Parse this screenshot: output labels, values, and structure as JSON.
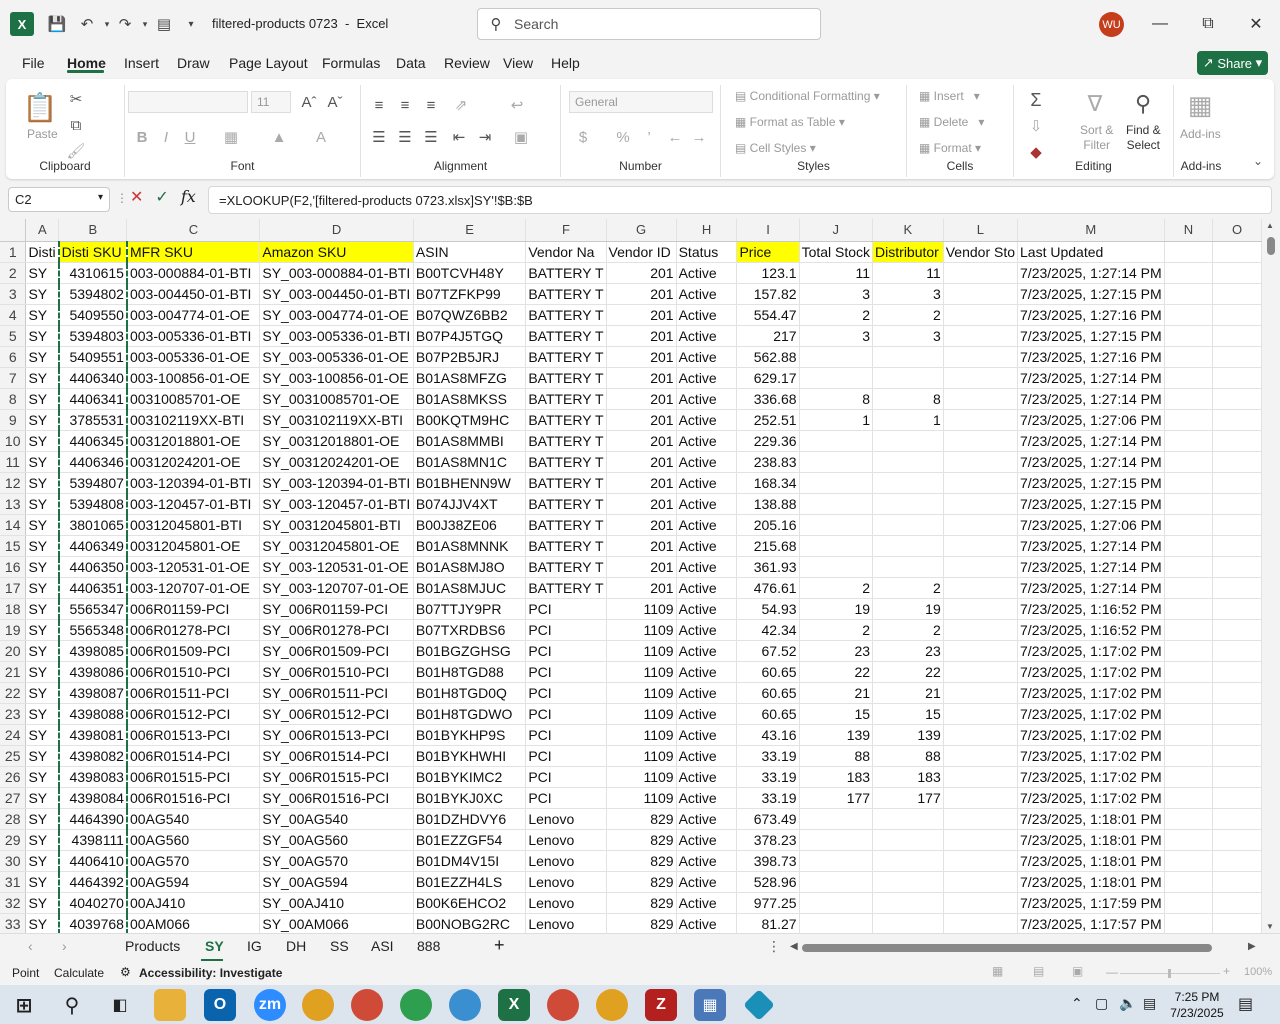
{
  "title_bar": {
    "filename": "filtered-products 0723",
    "app": "Excel",
    "search_placeholder": "Search",
    "user_initials": "WU",
    "app_logo": "X"
  },
  "menu": [
    "File",
    "Home",
    "Insert",
    "Draw",
    "Page Layout",
    "Formulas",
    "Data",
    "Review",
    "View",
    "Help"
  ],
  "share_label": "Share",
  "ribbon": {
    "clipboard": {
      "paste": "Paste",
      "label": "Clipboard"
    },
    "font": {
      "font_size": "11",
      "label": "Font"
    },
    "alignment": {
      "label": "Alignment"
    },
    "number": {
      "format": "General",
      "label": "Number"
    },
    "styles": {
      "conditional": "Conditional Formatting",
      "format_table": "Format as Table",
      "cell_styles": "Cell Styles",
      "label": "Styles"
    },
    "cells": {
      "insert": "Insert",
      "delete": "Delete",
      "format": "Format",
      "label": "Cells"
    },
    "editing": {
      "sort1": "Sort &",
      "sort2": "Filter",
      "find1": "Find &",
      "find2": "Select",
      "label": "Editing"
    },
    "addins": {
      "name": "Add-ins",
      "label": "Add-ins"
    }
  },
  "formula_bar": {
    "name_box": "C2",
    "formula": "=XLOOKUP(F2,'[filtered-products 0723.xlsx]SY'!$B:$B"
  },
  "columns": [
    "A",
    "B",
    "C",
    "D",
    "E",
    "F",
    "G",
    "H",
    "I",
    "J",
    "K",
    "L",
    "M",
    "N",
    "O"
  ],
  "header_row": [
    "Disti",
    "Disti SKU",
    "MFR SKU",
    "Amazon SKU",
    "ASIN",
    "Vendor Na",
    "Vendor ID",
    "Status",
    "Price",
    "Total Stock",
    "Distributor",
    "Vendor Sto",
    "Last Updated",
    "",
    ""
  ],
  "rows": [
    [
      "SY",
      "4310615",
      "003-000884-01-BTI",
      "SY_003-000884-01-BTI",
      "B00TCVH48Y",
      "BATTERY T",
      "201",
      "Active",
      "123.1",
      "11",
      "11",
      "",
      "7/23/2025, 1:27:14 PM"
    ],
    [
      "SY",
      "5394802",
      "003-004450-01-BTI",
      "SY_003-004450-01-BTI",
      "B07TZFKP99",
      "BATTERY T",
      "201",
      "Active",
      "157.82",
      "3",
      "3",
      "",
      "7/23/2025, 1:27:15 PM"
    ],
    [
      "SY",
      "5409550",
      "003-004774-01-OE",
      "SY_003-004774-01-OE",
      "B07QWZ6BB2",
      "BATTERY T",
      "201",
      "Active",
      "554.47",
      "2",
      "2",
      "",
      "7/23/2025, 1:27:16 PM"
    ],
    [
      "SY",
      "5394803",
      "003-005336-01-BTI",
      "SY_003-005336-01-BTI",
      "B07P4J5TGQ",
      "BATTERY T",
      "201",
      "Active",
      "217",
      "3",
      "3",
      "",
      "7/23/2025, 1:27:15 PM"
    ],
    [
      "SY",
      "5409551",
      "003-005336-01-OE",
      "SY_003-005336-01-OE",
      "B07P2B5JRJ",
      "BATTERY T",
      "201",
      "Active",
      "562.88",
      "",
      "",
      "",
      "7/23/2025, 1:27:16 PM"
    ],
    [
      "SY",
      "4406340",
      "003-100856-01-OE",
      "SY_003-100856-01-OE",
      "B01AS8MFZG",
      "BATTERY T",
      "201",
      "Active",
      "629.17",
      "",
      "",
      "",
      "7/23/2025, 1:27:14 PM"
    ],
    [
      "SY",
      "4406341",
      "00310085701-OE",
      "SY_00310085701-OE",
      "B01AS8MKSS",
      "BATTERY T",
      "201",
      "Active",
      "336.68",
      "8",
      "8",
      "",
      "7/23/2025, 1:27:14 PM"
    ],
    [
      "SY",
      "3785531",
      "003102119XX-BTI",
      "SY_003102119XX-BTI",
      "B00KQTM9HC",
      "BATTERY T",
      "201",
      "Active",
      "252.51",
      "1",
      "1",
      "",
      "7/23/2025, 1:27:06 PM"
    ],
    [
      "SY",
      "4406345",
      "00312018801-OE",
      "SY_00312018801-OE",
      "B01AS8MMBI",
      "BATTERY T",
      "201",
      "Active",
      "229.36",
      "",
      "",
      "",
      "7/23/2025, 1:27:14 PM"
    ],
    [
      "SY",
      "4406346",
      "00312024201-OE",
      "SY_00312024201-OE",
      "B01AS8MN1C",
      "BATTERY T",
      "201",
      "Active",
      "238.83",
      "",
      "",
      "",
      "7/23/2025, 1:27:14 PM"
    ],
    [
      "SY",
      "5394807",
      "003-120394-01-BTI",
      "SY_003-120394-01-BTI",
      "B01BHENN9W",
      "BATTERY T",
      "201",
      "Active",
      "168.34",
      "",
      "",
      "",
      "7/23/2025, 1:27:15 PM"
    ],
    [
      "SY",
      "5394808",
      "003-120457-01-BTI",
      "SY_003-120457-01-BTI",
      "B074JJV4XT",
      "BATTERY T",
      "201",
      "Active",
      "138.88",
      "",
      "",
      "",
      "7/23/2025, 1:27:15 PM"
    ],
    [
      "SY",
      "3801065",
      "00312045801-BTI",
      "SY_00312045801-BTI",
      "B00J38ZE06",
      "BATTERY T",
      "201",
      "Active",
      "205.16",
      "",
      "",
      "",
      "7/23/2025, 1:27:06 PM"
    ],
    [
      "SY",
      "4406349",
      "00312045801-OE",
      "SY_00312045801-OE",
      "B01AS8MNNK",
      "BATTERY T",
      "201",
      "Active",
      "215.68",
      "",
      "",
      "",
      "7/23/2025, 1:27:14 PM"
    ],
    [
      "SY",
      "4406350",
      "003-120531-01-OE",
      "SY_003-120531-01-OE",
      "B01AS8MJ8O",
      "BATTERY T",
      "201",
      "Active",
      "361.93",
      "",
      "",
      "",
      "7/23/2025, 1:27:14 PM"
    ],
    [
      "SY",
      "4406351",
      "003-120707-01-OE",
      "SY_003-120707-01-OE",
      "B01AS8MJUC",
      "BATTERY T",
      "201",
      "Active",
      "476.61",
      "2",
      "2",
      "",
      "7/23/2025, 1:27:14 PM"
    ],
    [
      "SY",
      "5565347",
      "006R01159-PCI",
      "SY_006R01159-PCI",
      "B07TTJY9PR",
      "PCI",
      "1109",
      "Active",
      "54.93",
      "19",
      "19",
      "",
      "7/23/2025, 1:16:52 PM"
    ],
    [
      "SY",
      "5565348",
      "006R01278-PCI",
      "SY_006R01278-PCI",
      "B07TXRDBS6",
      "PCI",
      "1109",
      "Active",
      "42.34",
      "2",
      "2",
      "",
      "7/23/2025, 1:16:52 PM"
    ],
    [
      "SY",
      "4398085",
      "006R01509-PCI",
      "SY_006R01509-PCI",
      "B01BGZGHSG",
      "PCI",
      "1109",
      "Active",
      "67.52",
      "23",
      "23",
      "",
      "7/23/2025, 1:17:02 PM"
    ],
    [
      "SY",
      "4398086",
      "006R01510-PCI",
      "SY_006R01510-PCI",
      "B01H8TGD88",
      "PCI",
      "1109",
      "Active",
      "60.65",
      "22",
      "22",
      "",
      "7/23/2025, 1:17:02 PM"
    ],
    [
      "SY",
      "4398087",
      "006R01511-PCI",
      "SY_006R01511-PCI",
      "B01H8TGD0Q",
      "PCI",
      "1109",
      "Active",
      "60.65",
      "21",
      "21",
      "",
      "7/23/2025, 1:17:02 PM"
    ],
    [
      "SY",
      "4398088",
      "006R01512-PCI",
      "SY_006R01512-PCI",
      "B01H8TGDWO",
      "PCI",
      "1109",
      "Active",
      "60.65",
      "15",
      "15",
      "",
      "7/23/2025, 1:17:02 PM"
    ],
    [
      "SY",
      "4398081",
      "006R01513-PCI",
      "SY_006R01513-PCI",
      "B01BYKHP9S",
      "PCI",
      "1109",
      "Active",
      "43.16",
      "139",
      "139",
      "",
      "7/23/2025, 1:17:02 PM"
    ],
    [
      "SY",
      "4398082",
      "006R01514-PCI",
      "SY_006R01514-PCI",
      "B01BYKHWHI",
      "PCI",
      "1109",
      "Active",
      "33.19",
      "88",
      "88",
      "",
      "7/23/2025, 1:17:02 PM"
    ],
    [
      "SY",
      "4398083",
      "006R01515-PCI",
      "SY_006R01515-PCI",
      "B01BYKIMC2",
      "PCI",
      "1109",
      "Active",
      "33.19",
      "183",
      "183",
      "",
      "7/23/2025, 1:17:02 PM"
    ],
    [
      "SY",
      "4398084",
      "006R01516-PCI",
      "SY_006R01516-PCI",
      "B01BYKJ0XC",
      "PCI",
      "1109",
      "Active",
      "33.19",
      "177",
      "177",
      "",
      "7/23/2025, 1:17:02 PM"
    ],
    [
      "SY",
      "4464390",
      "00AG540",
      "SY_00AG540",
      "B01DZHDVY6",
      "Lenovo",
      "829",
      "Active",
      "673.49",
      "",
      "",
      "",
      "7/23/2025, 1:18:01 PM"
    ],
    [
      "SY",
      "4398111",
      "00AG560",
      "SY_00AG560",
      "B01EZZGF54",
      "Lenovo",
      "829",
      "Active",
      "378.23",
      "",
      "",
      "",
      "7/23/2025, 1:18:01 PM"
    ],
    [
      "SY",
      "4406410",
      "00AG570",
      "SY_00AG570",
      "B01DM4V15I",
      "Lenovo",
      "829",
      "Active",
      "398.73",
      "",
      "",
      "",
      "7/23/2025, 1:18:01 PM"
    ],
    [
      "SY",
      "4464392",
      "00AG594",
      "SY_00AG594",
      "B01EZZH4LS",
      "Lenovo",
      "829",
      "Active",
      "528.96",
      "",
      "",
      "",
      "7/23/2025, 1:18:01 PM"
    ],
    [
      "SY",
      "4040270",
      "00AJ410",
      "SY_00AJ410",
      "B00K6EHCO2",
      "Lenovo",
      "829",
      "Active",
      "977.25",
      "",
      "",
      "",
      "7/23/2025, 1:17:59 PM"
    ],
    [
      "SY",
      "4039768",
      "00AM066",
      "SY_00AM066",
      "B00NOBG2RC",
      "Lenovo",
      "829",
      "Active",
      "81.27",
      "",
      "",
      "",
      "7/23/2025, 1:17:57 PM"
    ]
  ],
  "sheet_tabs": [
    "Products",
    "SY",
    "IG",
    "DH",
    "SS",
    "ASI",
    "888"
  ],
  "active_tab": "SY",
  "status": {
    "mode": "Point",
    "calc": "Calculate",
    "accessibility": "Accessibility: Investigate",
    "zoom": "100%"
  },
  "taskbar": {
    "time": "7:25 PM",
    "date": "7/23/2025"
  }
}
